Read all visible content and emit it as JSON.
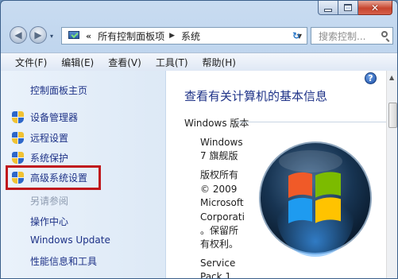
{
  "caption": {
    "minimize_glyph": "",
    "maximize_glyph": "",
    "close_glyph": "✕"
  },
  "nav": {
    "back_glyph": "◀",
    "forward_glyph": "▶",
    "history_glyph": "▾",
    "refresh_glyph": "↻"
  },
  "address": {
    "chevron": "«",
    "crumbs": [
      "所有控制面板项",
      "系统"
    ],
    "separator": "▶",
    "dropdown_glyph": "▼"
  },
  "search": {
    "placeholder": "搜索控制..."
  },
  "menu": {
    "items": [
      "文件(F)",
      "编辑(E)",
      "查看(V)",
      "工具(T)",
      "帮助(H)"
    ]
  },
  "left_pane": {
    "home_link": "控制面板主页",
    "tasks": [
      "设备管理器",
      "远程设置",
      "系统保护",
      "高级系统设置"
    ],
    "see_also_header": "另请参阅",
    "see_also": [
      "操作中心",
      "Windows Update",
      "性能信息和工具"
    ]
  },
  "help_glyph": "?",
  "main": {
    "title": "查看有关计算机的基本信息",
    "section": "Windows 版本",
    "edition_lines": [
      "Windows",
      "7 旗舰版"
    ],
    "copyright_lines": [
      "版权所有",
      "© 2009",
      "Microsoft",
      "Corporati",
      "。保留所",
      "有权利。"
    ],
    "service_lines": [
      "Service",
      "Pack 1"
    ]
  },
  "scrollbar": {
    "up_glyph": "▲"
  },
  "colors": {
    "link": "#1e3287",
    "highlight_border": "#c0171c"
  }
}
